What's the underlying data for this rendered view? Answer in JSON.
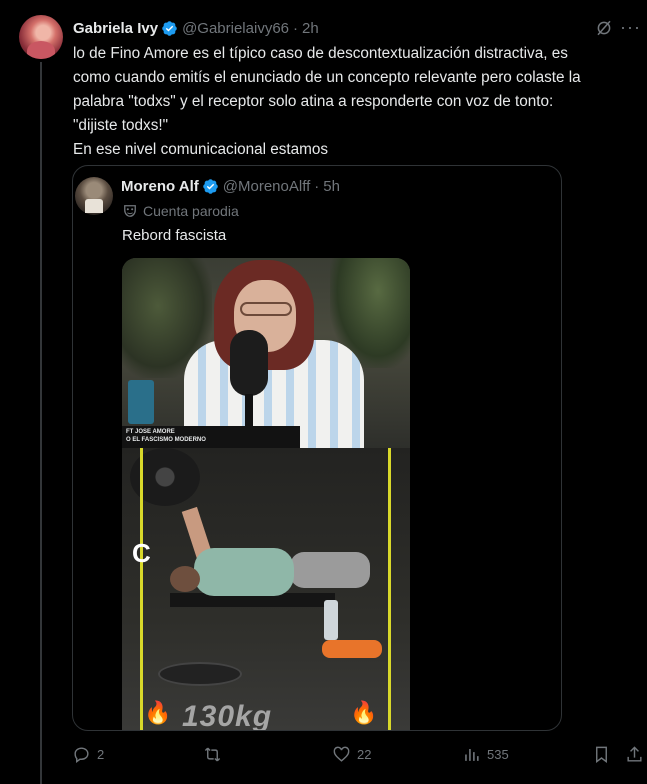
{
  "tweet": {
    "author_name": "Gabriela Ivy",
    "handle": "@Gabrielaivy66",
    "separator": "·",
    "time": "2h",
    "text": "lo de Fino Amore es el típico caso de descontextualización distractiva, es\ncomo cuando emitís el enunciado de un concepto relevante pero colaste la\npalabra \"todxs\" y el receptor solo atina a responderte con voz de tonto:\n\"dijiste todxs!\"\nEn ese nivel comunicacional estamos",
    "more_label": "···"
  },
  "quote": {
    "author_name": "Moreno Alf",
    "handle": "@MorenoAlff",
    "separator": "·",
    "time": "5h",
    "label": "Cuenta parodia",
    "text": "Rebord fascista",
    "video": {
      "caption_line1": "FT JOSE AMORE",
      "caption_line2": "O EL FASCISMO MODERNO",
      "overlay_letter": "C",
      "weight_text": "130kg"
    }
  },
  "actions": {
    "replies": "2",
    "retweets": "",
    "likes": "22",
    "views": "535"
  },
  "colors": {
    "background": "#000000",
    "text": "#e7e9ea",
    "muted": "#71767b",
    "verified": "#1d9bf0",
    "border": "#2f3336"
  }
}
